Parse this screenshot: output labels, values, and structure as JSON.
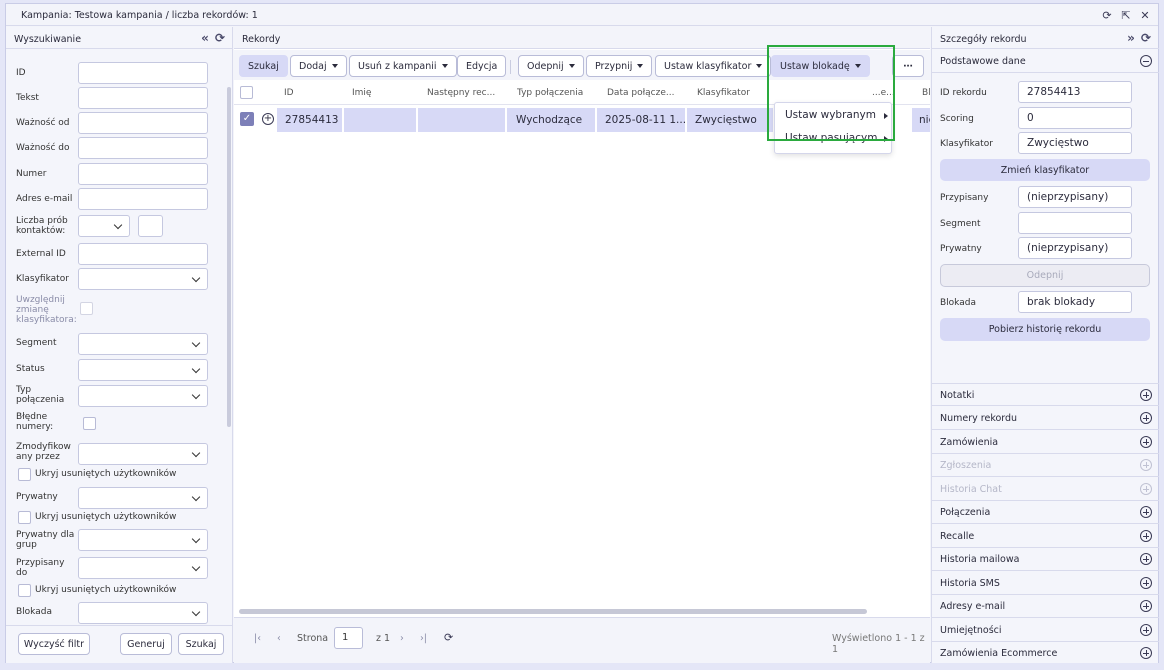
{
  "window": {
    "title": "Kampania: Testowa kampania / liczba rekordów: 1"
  },
  "search_panel": {
    "title": "Wyszukiwanie",
    "fields": {
      "id": "ID",
      "tekst": "Tekst",
      "waznosc_od": "Ważność od",
      "waznosc_do": "Ważność do",
      "numer": "Numer",
      "email": "Adres e-mail",
      "liczba_prob": "Liczba prób kontaktów:",
      "external_id": "External ID",
      "klasyfikator": "Klasyfikator",
      "uwzglednij": "Uwzględnij zmianę klasyfikatora:",
      "segment": "Segment",
      "status": "Status",
      "typ_polaczenia": "Typ połączenia",
      "bledne_numery": "Błędne numery:",
      "zmodyfikowany": "Zmodyfikow any przez",
      "ukryj": "Ukryj usuniętych użytkowników",
      "prywatny": "Prywatny",
      "prywatny_grup": "Prywatny dla grup",
      "przypisany_do": "Przypisany do",
      "blokada": "Blokada"
    },
    "buttons": {
      "clear": "Wyczyść filtr",
      "generate": "Generuj",
      "search": "Szukaj"
    }
  },
  "records_panel": {
    "title": "Rekordy",
    "toolbar": {
      "szukaj": "Szukaj",
      "dodaj": "Dodaj",
      "usun": "Usuń z kampanii",
      "edycja": "Edycja",
      "odepnij": "Odepnij",
      "przypnij": "Przypnij",
      "klasyfikator": "Ustaw klasyfikator",
      "blokada": "Ustaw blokadę",
      "more": "⋯"
    },
    "columns": [
      "ID",
      "Imię",
      "Następny rec...",
      "Typ połączenia",
      "Data połącze...",
      "Klasyfikator",
      "...e...",
      "Bl"
    ],
    "rows": [
      {
        "id": "27854413",
        "imie": "",
        "nastepny": "",
        "typ": "Wychodzące",
        "data": "2025-08-11 1...",
        "klasyfikator": "Zwycięstwo",
        "blokada": "nie"
      }
    ],
    "dropdown": [
      "Ustaw wybranym",
      "Ustaw pasującym"
    ],
    "pager": {
      "strona": "Strona",
      "page": "1",
      "of": "z 1",
      "summary": "Wyświetlono 1 - 1 z 1"
    }
  },
  "details_panel": {
    "title": "Szczegóły rekordu",
    "section": "Podstawowe dane",
    "fields": {
      "id_label": "ID rekordu",
      "id_value": "27854413",
      "scoring_label": "Scoring",
      "scoring_value": "0",
      "klas_label": "Klasyfikator",
      "klas_value": "Zwycięstwo",
      "przyp_label": "Przypisany",
      "przyp_value": "(nieprzypisany)",
      "segment_label": "Segment",
      "segment_value": "",
      "pryw_label": "Prywatny",
      "pryw_value": "(nieprzypisany)",
      "blokada_label": "Blokada",
      "blokada_value": "brak blokady"
    },
    "buttons": {
      "zmien": "Zmień klasyfikator",
      "odepnij": "Odepnij",
      "historia": "Pobierz historię rekordu"
    },
    "sections": [
      {
        "label": "Notatki",
        "disabled": false
      },
      {
        "label": "Numery rekordu",
        "disabled": false
      },
      {
        "label": "Zamówienia",
        "disabled": false
      },
      {
        "label": "Zgłoszenia",
        "disabled": true
      },
      {
        "label": "Historia Chat",
        "disabled": true
      },
      {
        "label": "Połączenia",
        "disabled": false
      },
      {
        "label": "Recalle",
        "disabled": false
      },
      {
        "label": "Historia mailowa",
        "disabled": false
      },
      {
        "label": "Historia SMS",
        "disabled": false
      },
      {
        "label": "Adresy e-mail",
        "disabled": false
      },
      {
        "label": "Umiejętności",
        "disabled": false
      },
      {
        "label": "Zamówienia Ecommerce",
        "disabled": false
      }
    ]
  },
  "colors": {
    "accent": "#d7d9f6",
    "highlight": "#2aaa3e"
  }
}
